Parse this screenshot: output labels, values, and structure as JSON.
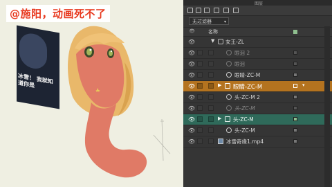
{
  "caption": "@施阳，动画死不了",
  "poster_text": "冰雪！ 我就知道你是",
  "panel": {
    "title": "图层",
    "filter_label": "无过滤器",
    "header_label": "名称",
    "colors": {
      "orange": "#b4731f",
      "green": "#2f6a5a",
      "panel": "#353535"
    }
  },
  "layers": [
    {
      "name": "女王-ZL",
      "icon": "folder-link-icon"
    },
    {
      "name": "眼泪 2",
      "icon": "shape-icon"
    },
    {
      "name": "眼泪",
      "icon": "shape-icon"
    },
    {
      "name": "眼睛-ZC-M",
      "icon": "shape-icon"
    },
    {
      "name": "眼睛-ZC-M",
      "icon": "folder-icon"
    },
    {
      "name": "头-ZC-M 2",
      "icon": "shape-icon"
    },
    {
      "name": "头-ZC-M",
      "icon": "shape-icon"
    },
    {
      "name": "头-ZC-M",
      "icon": "folder-icon"
    },
    {
      "name": "头-ZC-M",
      "icon": "shape-icon"
    },
    {
      "name": "冰雪奇缘1.mp4",
      "icon": "video-icon"
    }
  ]
}
